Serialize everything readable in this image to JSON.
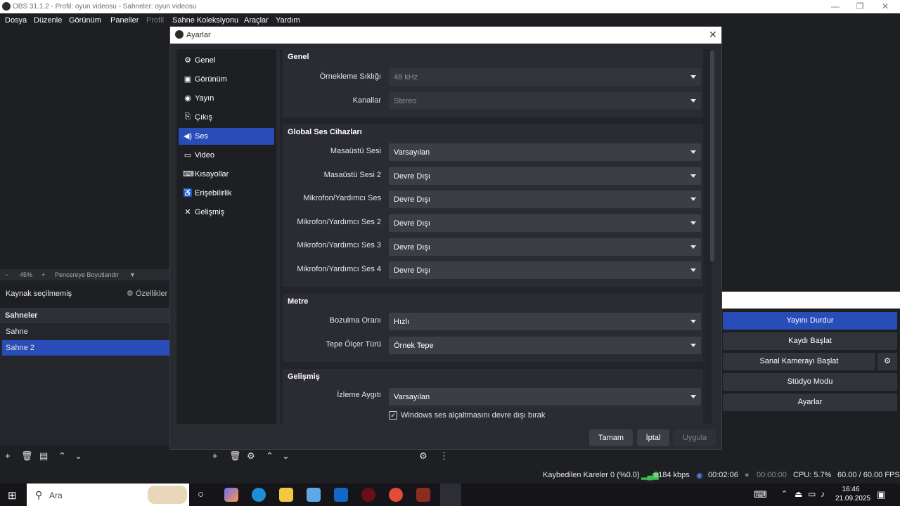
{
  "window": {
    "title": "OBS 31.1.2 - Profil: oyun videosu - Sahneler: oyun videosu"
  },
  "menu": [
    {
      "label": "Dosya"
    },
    {
      "label": "Düzenle"
    },
    {
      "label": "Görünüm"
    },
    {
      "label": "Paneller"
    },
    {
      "label": "Profil"
    },
    {
      "label": "Sahne Koleksiyonu"
    },
    {
      "label": "Araçlar"
    },
    {
      "label": "Yardım"
    }
  ],
  "preview": {
    "zoom_minus": "−",
    "zoom": "45%",
    "zoom_plus": "+",
    "fit": "Pencereye Boyutlandır"
  },
  "sources_bar": {
    "no_source": "Kaynak seçilmemiş",
    "properties": "Özellikler"
  },
  "scenes": {
    "header": "Sahneler",
    "items": [
      "Sahne",
      "Sahne 2"
    ],
    "selected": "Sahne 2"
  },
  "controls": {
    "buttons": [
      "Yayını Durdur",
      "Kaydı Başlat",
      "Sanal Kamerayı Başlat",
      "Stüdyo Modu",
      "Ayarlar"
    ]
  },
  "status": {
    "dropped": "Kaybedilen Kareler 0 (%0.0)",
    "bitrate": "8184 kbps",
    "stream_time": "00:02:06",
    "rec_time": "00:00:00",
    "cpu": "CPU: 5.7%",
    "fps": "60.00 / 60.00 FPS"
  },
  "taskbar": {
    "search_placeholder": "Ara",
    "time": "16:46",
    "date": "21.09.2025"
  },
  "dialog": {
    "title": "Ayarlar",
    "nav": [
      {
        "label": "Genel",
        "icon": "gear-icon"
      },
      {
        "label": "Görünüm",
        "icon": "appearance-icon"
      },
      {
        "label": "Yayın",
        "icon": "broadcast-icon"
      },
      {
        "label": "Çıkış",
        "icon": "output-icon"
      },
      {
        "label": "Ses",
        "icon": "speaker-icon"
      },
      {
        "label": "Video",
        "icon": "monitor-icon"
      },
      {
        "label": "Kısayollar",
        "icon": "keyboard-icon"
      },
      {
        "label": "Erişebilirlik",
        "icon": "accessibility-icon"
      },
      {
        "label": "Gelişmiş",
        "icon": "tools-icon"
      }
    ],
    "selected_nav": "Ses",
    "groups": {
      "general": {
        "title": "Genel",
        "sample_rate_label": "Örnekleme Sıklığı",
        "sample_rate": "48 kHz",
        "channels_label": "Kanallar",
        "channels": "Stereo"
      },
      "devices": {
        "title": "Global Ses Cihazları",
        "desktop1_label": "Masaüstü Sesi",
        "desktop1": "Varsayılan",
        "desktop2_label": "Masaüstü Sesi 2",
        "desktop2": "Devre Dışı",
        "mic1_label": "Mikrofon/Yardımcı Ses",
        "mic1": "Devre Dışı",
        "mic2_label": "Mikrofon/Yardımcı Ses 2",
        "mic2": "Devre Dışı",
        "mic3_label": "Mikrofon/Yardımcı Ses 3",
        "mic3": "Devre Dışı",
        "mic4_label": "Mikrofon/Yardımcı Ses 4",
        "mic4": "Devre Dışı"
      },
      "meters": {
        "title": "Metre",
        "decay_label": "Bozulma Oranı",
        "decay": "Hızlı",
        "peak_label": "Tepe Ölçer Türü",
        "peak": "Örnek Tepe"
      },
      "advanced": {
        "title": "Gelişmiş",
        "monitor_label": "İzleme Aygıtı",
        "monitor": "Varsayılan",
        "ducking_label": "Windows ses alçaltmasını devre dışı bırak",
        "ducking_checked": true
      }
    },
    "buttons": {
      "ok": "Tamam",
      "cancel": "İptal",
      "apply": "Uygula"
    }
  }
}
